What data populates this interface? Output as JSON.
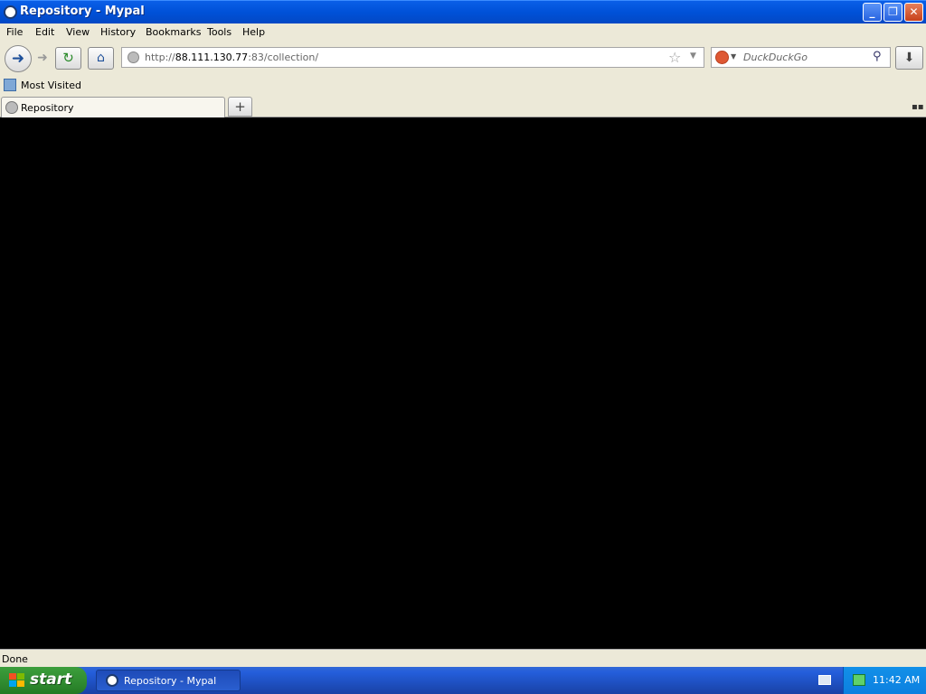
{
  "window": {
    "title": "Repository - Mypal"
  },
  "menu": [
    "File",
    "Edit",
    "View",
    "History",
    "Bookmarks",
    "Tools",
    "Help"
  ],
  "navigation": {
    "url_scheme": "http://",
    "url_host": "88.111.130.77",
    "url_rest": ":83/collection/",
    "search_placeholder": "DuckDuckGo"
  },
  "bookmarks": [
    {
      "label": "Most Visited"
    }
  ],
  "tabs": [
    {
      "label": "Repository",
      "active": true
    }
  ],
  "status": {
    "text": "Done"
  },
  "taskbar": {
    "start_label": "start",
    "items": [
      {
        "label": "Repository - Mypal"
      }
    ],
    "clock": "11:42 AM"
  },
  "colors": {
    "content_bg": "#000000",
    "titlebar": "#0a5fe8",
    "taskbar": "#245edb",
    "start": "#3c9e3c"
  }
}
